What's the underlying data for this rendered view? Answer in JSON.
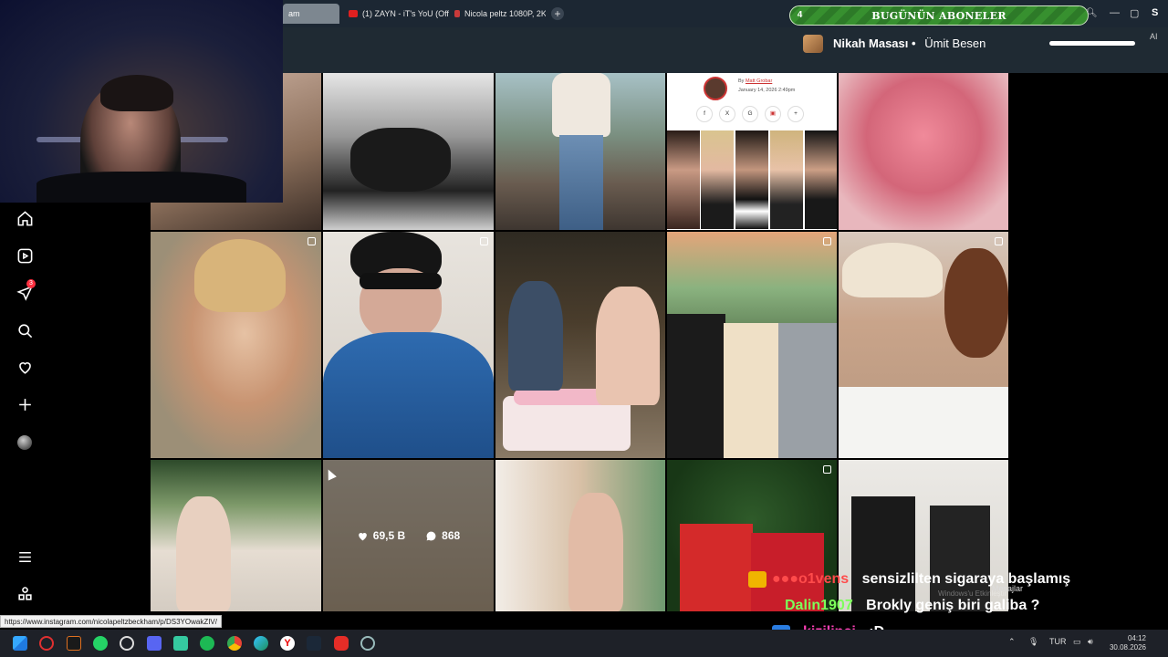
{
  "browser": {
    "tabs": [
      {
        "label": "am",
        "active": true
      },
      {
        "label": "(1) ZAYN - iT's YoU (Offici",
        "active": false
      },
      {
        "label": "Nicola peltz 1080P, 2K, 4K",
        "active": false
      }
    ],
    "new_tab": "+",
    "status_url": "https://www.instagram.com/nicolapeltzbeckham/p/DS3YOwakZIV/"
  },
  "subscriber_widget": {
    "count": "4",
    "title": "BUGÜNÜN ABONELER"
  },
  "window_controls": {
    "minimize": "—",
    "maximize": "▢",
    "close": "S"
  },
  "now_playing": {
    "title": "Nikah Masası",
    "separator": "•",
    "artist": "Ümit Besen",
    "progress": 1.0,
    "ai_label": "AI"
  },
  "post_overlay": {
    "likes": "69,5 B",
    "comments": "868"
  },
  "article_card": {
    "by_prefix": "By",
    "author": "Matt Grobar",
    "date": "January 14, 2026 2:49pm",
    "share_icons": [
      "f",
      "X",
      "G",
      "▣",
      "+"
    ]
  },
  "chat": [
    {
      "user": "●●●o1vens",
      "message": "sensizlilten sigaraya başlamış",
      "user_color": "#ff4b4b"
    },
    {
      "user": "Dalin1907",
      "message": "Brokly geniş biri galiba ?",
      "user_color": "#7cff5a"
    },
    {
      "user": "kizilinci",
      "message": ":D",
      "user_color": "#ff3fb7"
    }
  ],
  "notification": {
    "label": "Mesajlar"
  },
  "watermark": "Windows'u Etkinleştir",
  "sidebar": {
    "notifications_badge": "3"
  },
  "system_tray": {
    "language": "TUR",
    "time": "04:12",
    "date": "30.08.2026"
  }
}
